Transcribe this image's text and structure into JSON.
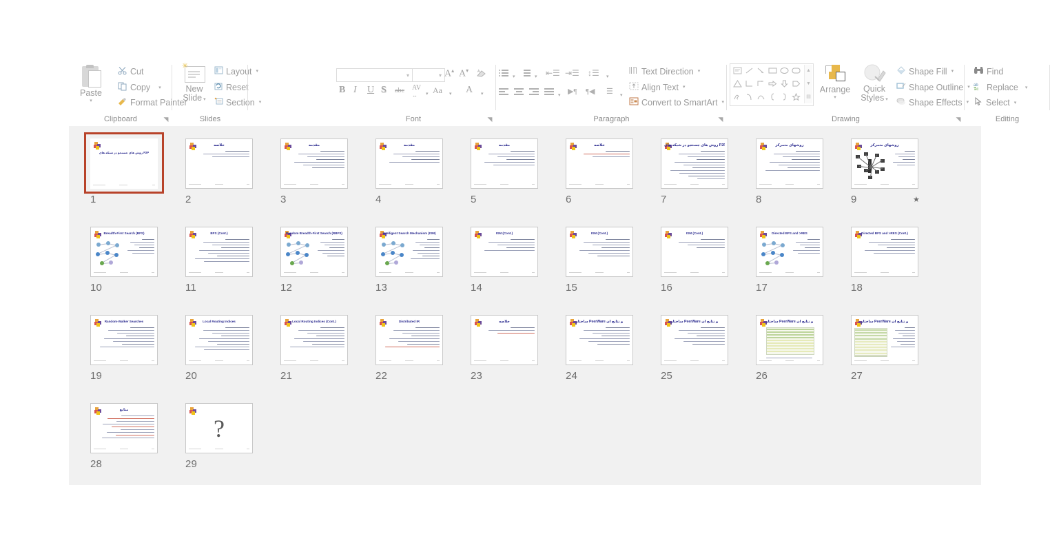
{
  "ribbon": {
    "groups": [
      {
        "name": "Clipboard",
        "label": "Clipboard",
        "paste_label": "Paste",
        "items": [
          {
            "label": "Cut",
            "icon": "scissors-icon"
          },
          {
            "label": "Copy",
            "icon": "copy-icon"
          },
          {
            "label": "Format Painter",
            "icon": "format-painter-icon"
          }
        ]
      },
      {
        "name": "Slides",
        "label": "Slides",
        "new_slide_label": "New\nSlide",
        "new_slide_line1": "New",
        "new_slide_line2": "Slide",
        "items": [
          {
            "label": "Layout",
            "icon": "layout-icon"
          },
          {
            "label": "Reset",
            "icon": "reset-icon"
          },
          {
            "label": "Section",
            "icon": "section-icon"
          }
        ]
      },
      {
        "name": "Font",
        "label": "Font",
        "font_name_value": "",
        "font_size_value": "",
        "buttons": [
          {
            "label": "B",
            "name": "bold-button"
          },
          {
            "label": "I",
            "name": "italic-button"
          },
          {
            "label": "U",
            "name": "underline-button"
          },
          {
            "label": "S",
            "name": "shadow-button"
          },
          {
            "label": "abc",
            "name": "strikethrough-button"
          },
          {
            "label": "AV",
            "name": "character-spacing-button"
          },
          {
            "label": "Aa",
            "name": "change-case-button"
          },
          {
            "label": "A",
            "name": "font-color-button"
          }
        ],
        "grow_label": "A",
        "shrink_label": "A",
        "clear_format_label": "Clear All Formatting"
      },
      {
        "name": "Paragraph",
        "label": "Paragraph",
        "items": [
          {
            "label": "Text Direction",
            "icon": "text-direction-icon"
          },
          {
            "label": "Align Text",
            "icon": "align-text-icon"
          },
          {
            "label": "Convert to SmartArt",
            "icon": "smartart-icon"
          }
        ]
      },
      {
        "name": "Drawing",
        "label": "Drawing",
        "arrange_label": "Arrange",
        "quick_styles_line1": "Quick",
        "quick_styles_line2": "Styles",
        "items": [
          {
            "label": "Shape Fill",
            "icon": "shape-fill-icon"
          },
          {
            "label": "Shape Outline",
            "icon": "shape-outline-icon"
          },
          {
            "label": "Shape Effects",
            "icon": "shape-effects-icon"
          }
        ]
      },
      {
        "name": "Editing",
        "label": "Editing",
        "items": [
          {
            "label": "Find",
            "icon": "binoculars-icon"
          },
          {
            "label": "Replace",
            "icon": "replace-icon"
          },
          {
            "label": "Select",
            "icon": "select-cursor-icon"
          }
        ]
      }
    ]
  },
  "slide_sorter": {
    "selected_slide": 1,
    "total_slides": 29,
    "columns": 9,
    "slides": [
      {
        "number": "1",
        "title": "روش های جستجو در شبکه های P2P",
        "layout": "title",
        "animated": false,
        "body_lines": 0
      },
      {
        "number": "2",
        "title": "خلاصه",
        "layout": "bullets",
        "animated": false,
        "body_lines": 3,
        "highlight": "first"
      },
      {
        "number": "3",
        "title": "مقدمه",
        "layout": "bullets",
        "animated": false,
        "body_lines": 7
      },
      {
        "number": "4",
        "title": "مقدمه",
        "layout": "bullets",
        "animated": false,
        "body_lines": 5
      },
      {
        "number": "5",
        "title": "مقدمه",
        "layout": "bullets",
        "animated": false,
        "body_lines": 6
      },
      {
        "number": "6",
        "title": "خلاصه",
        "layout": "bullets",
        "animated": false,
        "body_lines": 3,
        "highlight": "second"
      },
      {
        "number": "7",
        "title": "روش های جستجو در شبکه های P2P",
        "layout": "bullets",
        "animated": false,
        "body_lines": 11
      },
      {
        "number": "8",
        "title": "روشهای متمرکز",
        "layout": "bullets",
        "animated": false,
        "body_lines": 8
      },
      {
        "number": "9",
        "title": "روشهای متمرکز",
        "layout": "diagram-network",
        "animated": true,
        "body_lines": 6
      },
      {
        "number": "10",
        "title": "Breadth-First Search (BFS)",
        "layout": "diagram-graph",
        "animated": false,
        "body_lines": 6
      },
      {
        "number": "11",
        "title": "BFS (Cont.)",
        "layout": "bullets",
        "animated": false,
        "body_lines": 9
      },
      {
        "number": "12",
        "title": "Random Breadth-First Search (RBFS)",
        "layout": "diagram-graph",
        "animated": false,
        "body_lines": 7
      },
      {
        "number": "13",
        "title": "Intelligent Search Mechanism (ISM)",
        "layout": "diagram-graph",
        "animated": false,
        "body_lines": 8
      },
      {
        "number": "14",
        "title": "ISM (Cont.)",
        "layout": "bullets",
        "animated": false,
        "body_lines": 5
      },
      {
        "number": "15",
        "title": "ISM (Cont.)",
        "layout": "bullets",
        "animated": false,
        "body_lines": 7
      },
      {
        "number": "16",
        "title": "ISM (Cont.)",
        "layout": "bullets",
        "animated": false,
        "body_lines": 4
      },
      {
        "number": "17",
        "title": "Directed BFS and >RES",
        "layout": "diagram-graph",
        "animated": false,
        "body_lines": 6
      },
      {
        "number": "18",
        "title": "Directed BFS and >RES (Cont.)",
        "layout": "bullets",
        "animated": false,
        "body_lines": 6
      },
      {
        "number": "19",
        "title": "Random-Walker Searches",
        "layout": "bullets",
        "animated": false,
        "body_lines": 8
      },
      {
        "number": "20",
        "title": "Local Routing Indices",
        "layout": "bullets",
        "animated": false,
        "body_lines": 9
      },
      {
        "number": "21",
        "title": "Local Routing Indices (Cont.)",
        "layout": "bullets",
        "animated": false,
        "body_lines": 8
      },
      {
        "number": "22",
        "title": "Distributed IR",
        "layout": "bullets",
        "animated": false,
        "body_lines": 8,
        "highlight": "last"
      },
      {
        "number": "23",
        "title": "خلاصه",
        "layout": "bullets",
        "animated": false,
        "body_lines": 3,
        "highlight": "third"
      },
      {
        "number": "24",
        "title": "ساختار PeerWare و نتایج آن",
        "layout": "bullets",
        "animated": false,
        "body_lines": 7
      },
      {
        "number": "25",
        "title": "ساختار PeerWare و نتایج آن",
        "layout": "bullets",
        "animated": false,
        "body_lines": 7
      },
      {
        "number": "26",
        "title": "ساختار PeerWare و نتایج آن",
        "layout": "chart",
        "animated": false,
        "body_lines": 1
      },
      {
        "number": "27",
        "title": "ساختار PeerWare و نتایج آن",
        "layout": "chart-bullets",
        "animated": false,
        "body_lines": 8
      },
      {
        "number": "28",
        "title": "منابع",
        "layout": "references",
        "animated": false,
        "body_lines": 9
      },
      {
        "number": "29",
        "title": "",
        "layout": "question",
        "animated": false,
        "body_lines": 0
      }
    ]
  },
  "colors": {
    "selection_border": "#b8432a",
    "sorter_background": "#f1f1f1",
    "ribbon_text": "#9b9b9b",
    "slide_title": "#2b2b8f",
    "highlight_red": "#b02020"
  }
}
